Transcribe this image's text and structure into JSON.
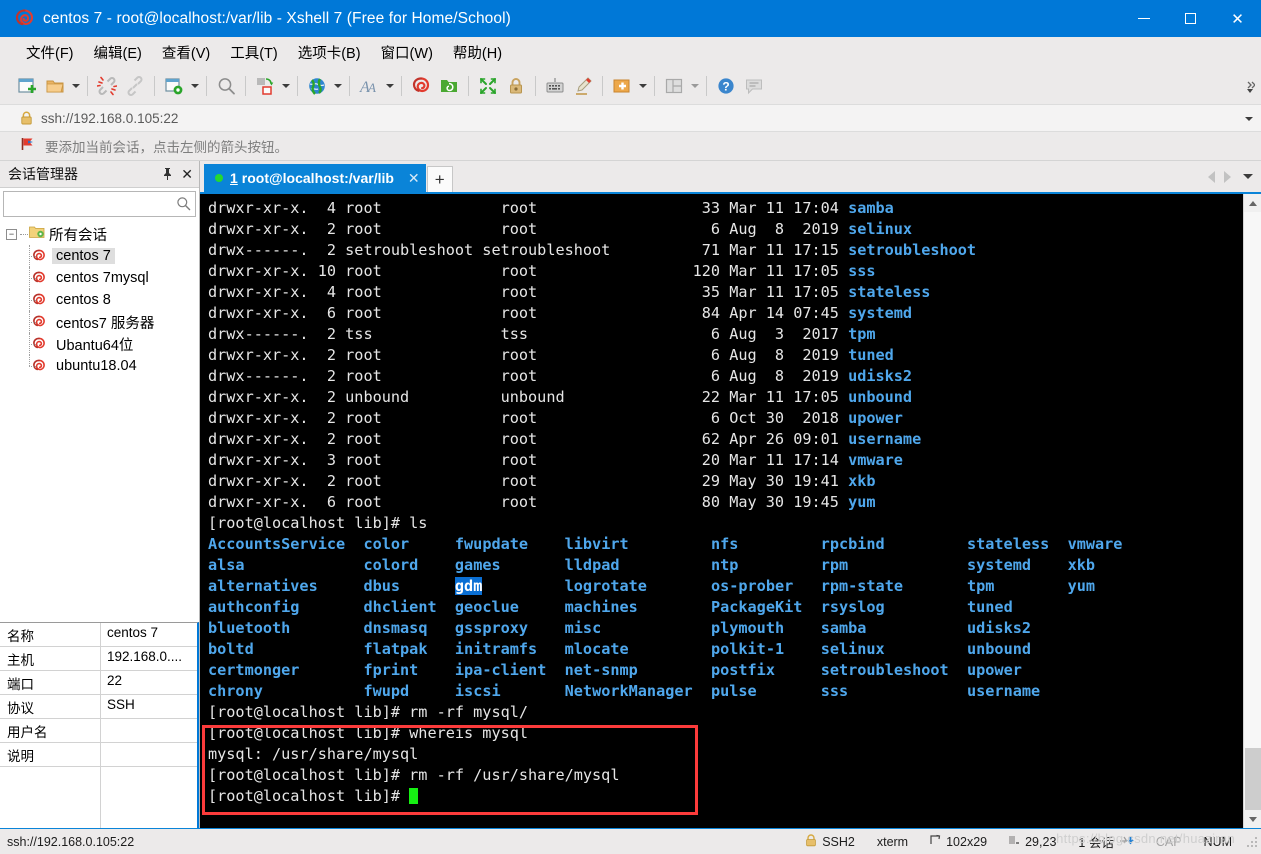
{
  "window": {
    "title": "centos 7 - root@localhost:/var/lib - Xshell 7 (Free for Home/School)",
    "app_icon": "xshell-snail-icon",
    "minimize_label": "",
    "maximize_label": "",
    "close_label": "✕",
    "accent_color": "#0078d7"
  },
  "menubar": {
    "items": [
      {
        "label": "文件(F)",
        "name": "menu-file"
      },
      {
        "label": "编辑(E)",
        "name": "menu-edit"
      },
      {
        "label": "查看(V)",
        "name": "menu-view"
      },
      {
        "label": "工具(T)",
        "name": "menu-tools"
      },
      {
        "label": "选项卡(B)",
        "name": "menu-tabs"
      },
      {
        "label": "窗口(W)",
        "name": "menu-window"
      },
      {
        "label": "帮助(H)",
        "name": "menu-help"
      }
    ]
  },
  "toolbar": {
    "icons": [
      "new-session-icon",
      "open-folder-icon",
      "disconnect-icon",
      "reconnect-icon",
      "session-properties-icon",
      "find-icon",
      "transfer-file-icon",
      "globe-icon",
      "font-icon",
      "snail-icon",
      "green-folder-icon",
      "fullscreen-icon",
      "lock-icon",
      "keyboard-icon",
      "highlight-pen-icon",
      "add-note-icon",
      "layout-icon",
      "help-icon",
      "chat-icon"
    ],
    "overflow_label": "»"
  },
  "addressbar": {
    "icon": "lock-icon",
    "value": "ssh://192.168.0.105:22",
    "placeholder": "ssh://",
    "dropdown": "chevron-down-icon"
  },
  "notice": {
    "icon": "red-flag-icon",
    "text": "要添加当前会话，点击左侧的箭头按钮。"
  },
  "sidebar": {
    "title": "会话管理器",
    "pin_icon": "pin-icon",
    "close_icon": "close-icon",
    "search": {
      "value": "",
      "placeholder": "",
      "icon": "search-icon"
    },
    "root": {
      "label": "所有会话",
      "icon": "folder-sessions-icon",
      "expander": "−"
    },
    "items": [
      {
        "label": "centos 7",
        "icon": "snail-icon",
        "selected": true
      },
      {
        "label": "centos 7mysql",
        "icon": "snail-icon",
        "selected": false
      },
      {
        "label": "centos 8",
        "icon": "snail-icon",
        "selected": false
      },
      {
        "label": "centos7 服务器",
        "icon": "snail-icon",
        "selected": false
      },
      {
        "label": "Ubantu64位",
        "icon": "snail-icon",
        "selected": false
      },
      {
        "label": "ubuntu18.04",
        "icon": "snail-icon",
        "selected": false
      }
    ],
    "properties": [
      {
        "key": "名称",
        "value": "centos 7"
      },
      {
        "key": "主机",
        "value": "192.168.0...."
      },
      {
        "key": "端口",
        "value": "22"
      },
      {
        "key": "协议",
        "value": "SSH"
      },
      {
        "key": "用户名",
        "value": ""
      },
      {
        "key": "说明",
        "value": ""
      }
    ]
  },
  "tabs": {
    "active": {
      "number": "1",
      "label": "root@localhost:/var/lib",
      "status_dot": "connected",
      "close_icon": "close-icon"
    },
    "new_tab_label": "+",
    "nav": [
      "prev-tab-icon",
      "next-tab-icon",
      "tab-list-icon"
    ]
  },
  "terminal": {
    "lines": [
      {
        "text": "drwxr-xr-x.  4 root             root                  33 Mar 11 17:04 ",
        "name": "samba",
        "type": "listing"
      },
      {
        "text": "drwxr-xr-x.  2 root             root                   6 Aug  8  2019 ",
        "name": "selinux",
        "type": "listing"
      },
      {
        "text": "drwx------.  2 setroubleshoot setroubleshoot          71 Mar 11 17:15 ",
        "name": "setroubleshoot",
        "type": "listing"
      },
      {
        "text": "drwxr-xr-x. 10 root             root                 120 Mar 11 17:05 ",
        "name": "sss",
        "type": "listing"
      },
      {
        "text": "drwxr-xr-x.  4 root             root                  35 Mar 11 17:05 ",
        "name": "stateless",
        "type": "listing"
      },
      {
        "text": "drwxr-xr-x.  6 root             root                  84 Apr 14 07:45 ",
        "name": "systemd",
        "type": "listing"
      },
      {
        "text": "drwx------.  2 tss              tss                    6 Aug  3  2017 ",
        "name": "tpm",
        "type": "listing"
      },
      {
        "text": "drwxr-xr-x.  2 root             root                   6 Aug  8  2019 ",
        "name": "tuned",
        "type": "listing"
      },
      {
        "text": "drwx------.  2 root             root                   6 Aug  8  2019 ",
        "name": "udisks2",
        "type": "listing"
      },
      {
        "text": "drwxr-xr-x.  2 unbound          unbound               22 Mar 11 17:05 ",
        "name": "unbound",
        "type": "listing"
      },
      {
        "text": "drwxr-xr-x.  2 root             root                   6 Oct 30  2018 ",
        "name": "upower",
        "type": "listing"
      },
      {
        "text": "drwxr-xr-x.  2 root             root                  62 Apr 26 09:01 ",
        "name": "username",
        "type": "listing"
      },
      {
        "text": "drwxr-xr-x.  3 root             root                  20 Mar 11 17:14 ",
        "name": "vmware",
        "type": "listing"
      },
      {
        "text": "drwxr-xr-x.  2 root             root                  29 May 30 19:41 ",
        "name": "xkb",
        "type": "listing"
      },
      {
        "text": "drwxr-xr-x.  6 root             root                  80 May 30 19:45 ",
        "name": "yum",
        "type": "listing"
      }
    ],
    "prompt_ls": "[root@localhost lib]# ls",
    "ls_columns": [
      [
        "AccountsService",
        "alsa",
        "alternatives",
        "authconfig",
        "bluetooth",
        "boltd",
        "certmonger",
        "chrony"
      ],
      [
        "color",
        "colord",
        "dbus",
        "dhclient",
        "dnsmasq",
        "flatpak",
        "fprint",
        "fwupd"
      ],
      [
        "fwupdate",
        "games",
        "gdm",
        "geoclue",
        "gssproxy",
        "initramfs",
        "ipa-client",
        "iscsi"
      ],
      [
        "libvirt",
        "lldpad",
        "logrotate",
        "machines",
        "misc",
        "mlocate",
        "net-snmp",
        "NetworkManager"
      ],
      [
        "nfs",
        "ntp",
        "os-prober",
        "PackageKit",
        "plymouth",
        "polkit-1",
        "postfix",
        "pulse"
      ],
      [
        "rpcbind",
        "rpm",
        "rpm-state",
        "rsyslog",
        "samba",
        "selinux",
        "setroubleshoot",
        "sss"
      ],
      [
        "stateless",
        "systemd",
        "tpm",
        "tuned",
        "udisks2",
        "unbound",
        "upower",
        "username"
      ],
      [
        "vmware",
        "xkb",
        "yum",
        "",
        "",
        "",
        "",
        ""
      ]
    ],
    "selected_entry": "gdm",
    "commands": [
      {
        "prompt": "[root@localhost lib]# ",
        "cmd": "rm -rf mysql/",
        "boxed": false
      },
      {
        "prompt": "[root@localhost lib]# ",
        "cmd": "whereis mysql",
        "boxed": true
      },
      {
        "prompt": "",
        "cmd": "mysql: /usr/share/mysql",
        "boxed": true
      },
      {
        "prompt": "[root@localhost lib]# ",
        "cmd": "rm -rf /usr/share/mysql",
        "boxed": true
      },
      {
        "prompt": "[root@localhost lib]# ",
        "cmd": "",
        "boxed": true,
        "cursor": true
      }
    ],
    "annotation_color": "#fb3b3b",
    "fg_color": "#e6e6e6",
    "dir_color": "#4fa7ec",
    "bg_color": "#000000"
  },
  "statusbar": {
    "connection": "ssh://192.168.0.105:22",
    "protocol": "SSH2",
    "terminal_type": "xterm",
    "size": "102x29",
    "cursor_pos": "29,23",
    "sessions": "1 会话",
    "cap": "CAP",
    "num": "NUM",
    "lock_icon": "lock-icon",
    "size_icon": "resize-icon",
    "pos_icon": "cursor-icon",
    "session_icon": "session-icon",
    "watermark": "https://blog.csdn.net/huaziran"
  }
}
